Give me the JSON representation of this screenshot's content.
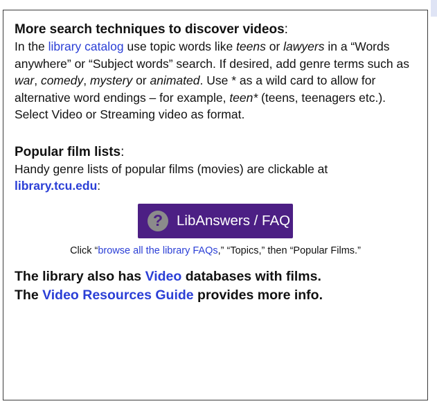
{
  "section1": {
    "title": "More search techniques to discover videos",
    "title_colon": ":",
    "t1": "In the ",
    "link_catalog": "library catalog",
    "t2": " use topic words like ",
    "ex_teens": "teens",
    "t3": " or ",
    "ex_lawyers": "lawyers",
    "t4": " in a “Words anywhere” or “Subject words” search.  If desired, add genre terms such as ",
    "g_war": "war",
    "c1": ", ",
    "g_comedy": "comedy",
    "c2": ", ",
    "g_mystery": "mystery",
    "t5": " or ",
    "g_animated": "animated",
    "t6": ". Use * as a wild card to allow for alternative word endings – for example, ",
    "ex_teen_star": "teen*",
    "t7": " (teens, teenagers etc.). Select Video or Streaming video as format."
  },
  "section2": {
    "title": "Popular film lists",
    "title_colon": ":",
    "t1": "Handy genre lists of popular films (movies) are clickable at ",
    "link_site": "library.tcu.edu",
    "t2": ":"
  },
  "button": {
    "icon_glyph": "?",
    "label": "LibAnswers / FAQ"
  },
  "click_note": {
    "t1": "Click “",
    "link_faqs": "browse all the library FAQs",
    "t2": ",” “Topics,” then “Popular Films.”"
  },
  "footer": {
    "l1_a": "The library also has ",
    "l1_link": "Video",
    "l1_b": " databases with films.",
    "l2_a": "The ",
    "l2_link": "Video Resources Guide",
    "l2_b": " provides more info."
  },
  "colors": {
    "link": "#2b3fd6",
    "button_bg": "#4c1f84",
    "border": "#3a3a3a"
  }
}
